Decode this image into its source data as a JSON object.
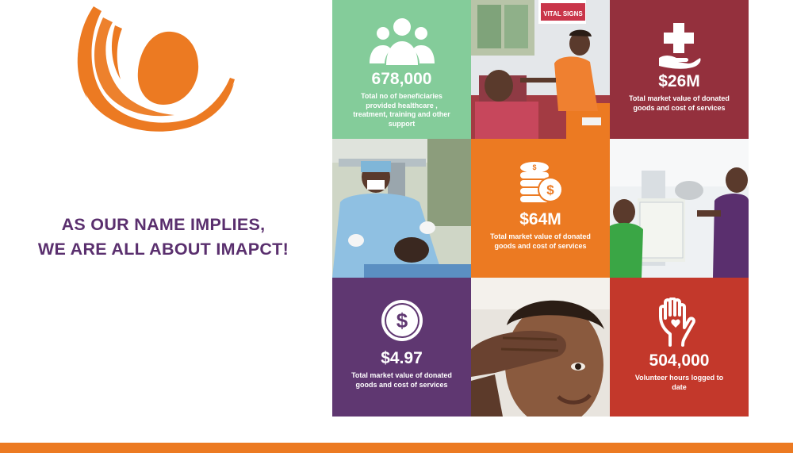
{
  "brand": {
    "primary_color": "#ec7a22",
    "logo_icon": "orange-swirl-logo-icon"
  },
  "tagline": {
    "line1": "AS OUR NAME IMPLIES,",
    "line2": "WE ARE ALL ABOUT IMAPCT!",
    "color": "#5a2f6e"
  },
  "tiles": {
    "beneficiaries": {
      "icon": "people-group-icon",
      "value": "678,000",
      "caption": "Total no of beneficiaries provided healthcare , treatment, training and other support",
      "color": "#84cc9a"
    },
    "donated_26m": {
      "icon": "medical-cross-hand-icon",
      "value": "$26M",
      "caption": "Total market value of donated goods and  cost of services",
      "color": "#94303d"
    },
    "donated_64m": {
      "icon": "coin-stack-icon",
      "value": "$64M",
      "caption": "Total market value of donated goods and  cost of services",
      "color": "#ec7a22"
    },
    "donated_497": {
      "icon": "dollar-coin-icon",
      "value": "$4.97",
      "caption": "Total market value of donated goods and  cost of services",
      "color": "#5f3771"
    },
    "volunteer": {
      "icon": "heart-hand-icon",
      "value": "504,000",
      "caption": "Volunteer hours logged to date",
      "color": "#c3382b"
    },
    "photo_vitals": {
      "sign_text": "VITAL SIGNS"
    }
  }
}
